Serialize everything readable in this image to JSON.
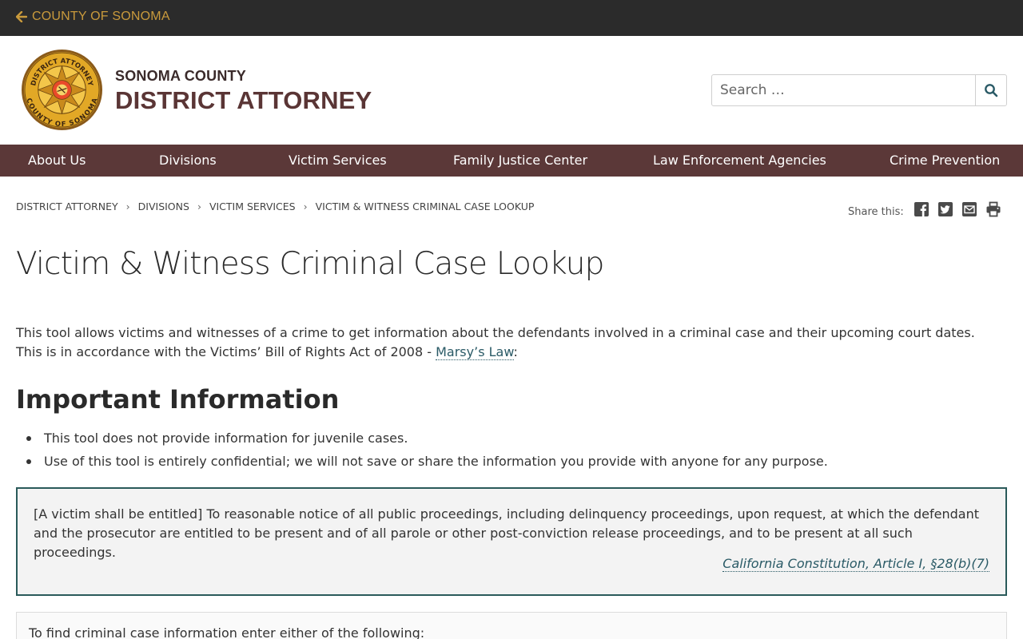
{
  "topbar": {
    "back_label": "COUNTY OF SONOMA"
  },
  "header": {
    "org_small": "SONOMA COUNTY",
    "org_big": "DISTRICT ATTORNEY",
    "seal_top_text": "DISTRICT ATTORNEY",
    "seal_bottom_text": "COUNTY OF SONOMA"
  },
  "search": {
    "placeholder": "Search …"
  },
  "nav": {
    "items": [
      {
        "label": "About Us"
      },
      {
        "label": "Divisions"
      },
      {
        "label": "Victim Services"
      },
      {
        "label": "Family Justice Center"
      },
      {
        "label": "Law Enforcement Agencies"
      },
      {
        "label": "Crime Prevention"
      }
    ]
  },
  "breadcrumb": {
    "items": [
      {
        "label": "DISTRICT ATTORNEY"
      },
      {
        "label": "DIVISIONS"
      },
      {
        "label": "VICTIM SERVICES"
      },
      {
        "label": "VICTIM & WITNESS CRIMINAL CASE LOOKUP"
      }
    ],
    "separator": "›"
  },
  "share": {
    "label": "Share this:",
    "icons": [
      "facebook-icon",
      "twitter-icon",
      "email-icon",
      "print-icon"
    ]
  },
  "main": {
    "title": "Victim & Witness Criminal Case Lookup",
    "intro_text": "This tool allows victims and witnesses of a crime to get information about the defendants involved in a criminal case and their upcoming court dates. This is in accordance with the Victims’ Bill of Rights Act of 2008 - ",
    "intro_link": "Marsy’s Law",
    "intro_after": ":",
    "section_heading": "Important Information",
    "bullets": [
      "This tool does not provide information for juvenile cases.",
      "Use of this tool is entirely confidential; we will not save or share the information you provide with anyone for any purpose."
    ],
    "quote_text": "[A victim shall be entitled] To reasonable notice of all public proceedings, including delinquency proceedings, upon request, at which the defendant and the prosecutor are entitled to be present and of all parole or other post-conviction release proceedings, and to be present at all such proceedings.",
    "quote_cite": "California Constitution, Article I, §28(b)(7)",
    "find_text": "To find criminal case information enter either of the following:"
  },
  "colors": {
    "topbar_bg": "#2b2b2b",
    "topbar_link": "#c99a3c",
    "nav_bg": "#5b3838",
    "accent_teal": "#2a5a66",
    "title_color": "#5a3535"
  }
}
